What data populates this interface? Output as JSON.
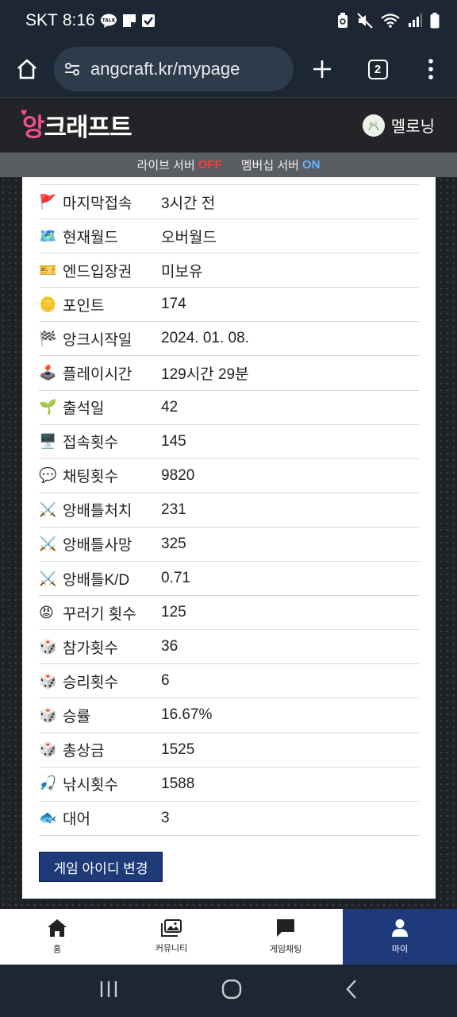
{
  "status_bar": {
    "carrier": "SKT",
    "time": "8:16",
    "talk_badge": "TALK"
  },
  "browser": {
    "url": "angcraft.kr/mypage",
    "tab_count": "2"
  },
  "site": {
    "logo_pink": "앙",
    "logo_rest": "크래프트",
    "username": "멜로닝"
  },
  "servers": {
    "live_label": "라이브 서버",
    "live_status": "OFF",
    "membership_label": "멤버십 서버",
    "membership_status": "ON"
  },
  "stats": [
    {
      "icon": "🚩",
      "label": "마지막접속",
      "value": "3시간 전"
    },
    {
      "icon": "🗺️",
      "label": "현재월드",
      "value": "오버월드"
    },
    {
      "icon": "🎫",
      "label": "엔드입장권",
      "value": "미보유"
    },
    {
      "icon": "🪙",
      "label": "포인트",
      "value": "174"
    },
    {
      "icon": "🏁",
      "label": "앙크시작일",
      "value": "2024. 01. 08."
    },
    {
      "icon": "🕹️",
      "label": "플레이시간",
      "value": "129시간 29분"
    },
    {
      "icon": "🌱",
      "label": "출석일",
      "value": "42"
    },
    {
      "icon": "🖥️",
      "label": "접속횟수",
      "value": "145"
    },
    {
      "icon": "💬",
      "label": "채팅횟수",
      "value": "9820"
    },
    {
      "icon": "⚔️",
      "label": "앙배틀처치",
      "value": "231"
    },
    {
      "icon": "⚔️",
      "label": "앙배틀사망",
      "value": "325"
    },
    {
      "icon": "⚔️",
      "label": "앙배틀K/D",
      "value": "0.71"
    },
    {
      "icon": "😡",
      "label": "꾸러기 횟수",
      "value": "125"
    },
    {
      "icon": "🎲",
      "label": "참가횟수",
      "value": "36"
    },
    {
      "icon": "🎲",
      "label": "승리횟수",
      "value": "6"
    },
    {
      "icon": "🎲",
      "label": "승률",
      "value": "16.67%"
    },
    {
      "icon": "🎲",
      "label": "총상금",
      "value": "1525"
    },
    {
      "icon": "🎣",
      "label": "낚시횟수",
      "value": "1588"
    },
    {
      "icon": "🐟",
      "label": "대어",
      "value": "3"
    }
  ],
  "change_button": "게임 아이디 변경",
  "bottom_nav": [
    {
      "label": "홈",
      "icon": "home-icon"
    },
    {
      "label": "커뮤니티",
      "icon": "images-icon"
    },
    {
      "label": "게임채팅",
      "icon": "chat-icon"
    },
    {
      "label": "마이",
      "icon": "user-icon"
    }
  ],
  "colors": {
    "accent_navy": "#1e3a78",
    "logo_pink": "#f2508a",
    "off_red": "#ff3b3b",
    "on_blue": "#5db6ff"
  }
}
